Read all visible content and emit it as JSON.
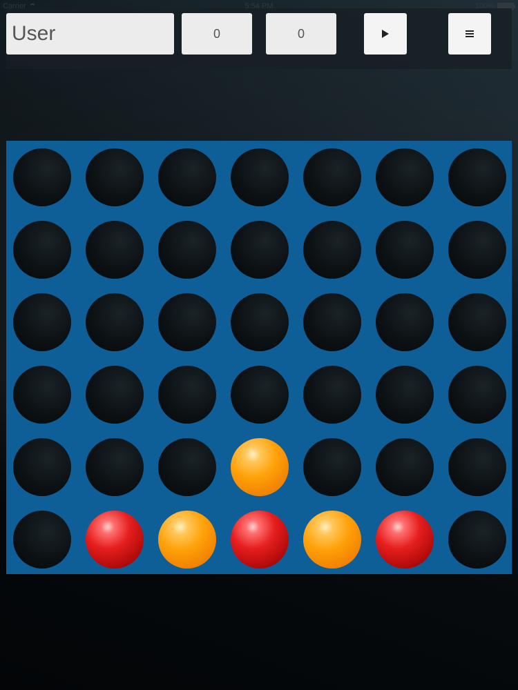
{
  "status_bar": {
    "carrier": "Carrier",
    "time": "5:54 PM",
    "battery": "100%"
  },
  "toolbar": {
    "player_name": "User",
    "score_player1": "0",
    "score_player2": "0",
    "play_icon": "play-icon",
    "menu_icon": "menu-icon"
  },
  "board": {
    "columns": 7,
    "rows": 6,
    "colors": {
      "board": "#0e5f97",
      "empty": "#0c1114",
      "red": "#e61e1e",
      "orange": "#ffa20a"
    },
    "cells": [
      [
        "empty",
        "empty",
        "empty",
        "empty",
        "empty",
        "empty",
        "empty"
      ],
      [
        "empty",
        "empty",
        "empty",
        "empty",
        "empty",
        "empty",
        "empty"
      ],
      [
        "empty",
        "empty",
        "empty",
        "empty",
        "empty",
        "empty",
        "empty"
      ],
      [
        "empty",
        "empty",
        "empty",
        "empty",
        "empty",
        "empty",
        "empty"
      ],
      [
        "empty",
        "empty",
        "empty",
        "orange",
        "empty",
        "empty",
        "empty"
      ],
      [
        "empty",
        "red",
        "orange",
        "red",
        "orange",
        "red",
        "empty"
      ]
    ]
  }
}
